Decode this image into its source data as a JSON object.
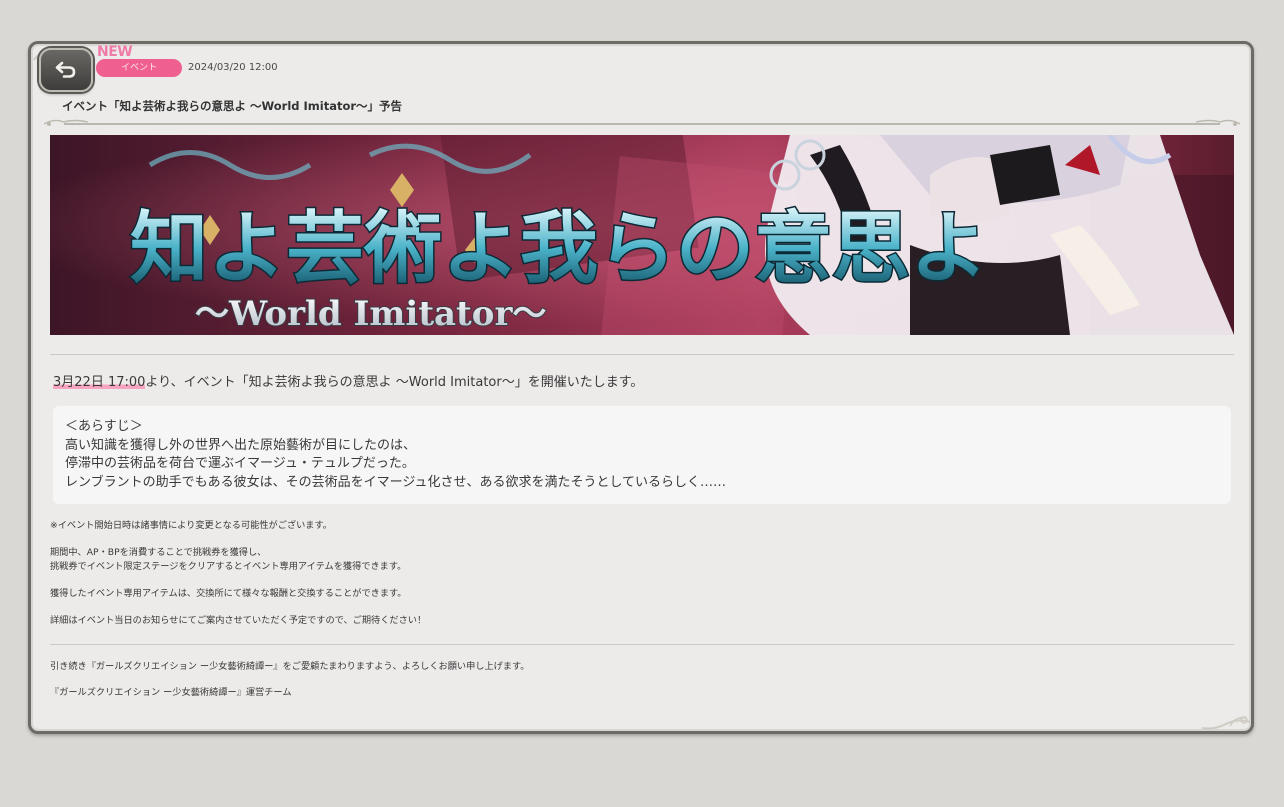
{
  "header": {
    "new_label": "NEW",
    "category": "イベント",
    "date": "2024/03/20 12:00",
    "title": "イベント「知よ芸術よ我らの意思よ 〜World Imitator〜」予告"
  },
  "banner": {
    "logo_main": "知よ芸術よ我らの意思よ",
    "logo_sub": "〜World Imitator〜"
  },
  "body": {
    "lead_highlight": "3月22日 17:00",
    "lead_rest": "より、イベント「知よ芸術よ我らの意思よ 〜World Imitator〜」を開催いたします。",
    "synopsis": [
      "＜あらすじ＞",
      "高い知識を獲得し外の世界へ出た原始藝術が目にしたのは、",
      "停滞中の芸術品を荷台で運ぶイマージュ・テュルプだった。",
      "レンブラントの助手でもある彼女は、その芸術品をイマージュ化させ、ある欲求を満たそうとしているらしく……"
    ],
    "notes": {
      "n1": "※イベント開始日時は諸事情により変更となる可能性がございます。",
      "n2a": "期間中、AP・BPを消費することで挑戦券を獲得し、",
      "n2b": "挑戦券でイベント限定ステージをクリアするとイベント専用アイテムを獲得できます。",
      "n3": "獲得したイベント専用アイテムは、交換所にて様々な報酬と交換することができます。",
      "n4": "詳細はイベント当日のお知らせにてご案内させていただく予定ですので、ご期待ください！"
    },
    "closing": {
      "c1": "引き続き『ガールズクリエイション ー少女藝術綺譚ー』をご愛顧たまわりますよう、よろしくお願い申し上げます。",
      "c2": "『ガールズクリエイション ー少女藝術綺譚ー』運営チーム"
    }
  },
  "colors": {
    "accent_pink": "#ef5f90",
    "new_pink": "#f07aa8",
    "panel_bg": "#ecebea",
    "page_bg": "#d9d8d4"
  },
  "icons": {
    "back": "back-arrow-icon"
  }
}
